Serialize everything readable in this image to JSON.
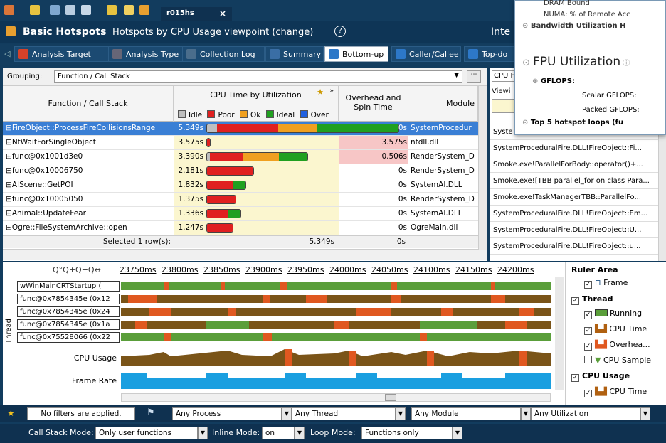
{
  "project_tab": {
    "label": "r015hs",
    "close": "×"
  },
  "header": {
    "title": "Basic Hotspots",
    "subtitle_prefix": "Hotspots by CPU Usage viewpoint (",
    "change": "change",
    "subtitle_suffix": ")",
    "help": "?",
    "right_text": "Inte"
  },
  "toolbar": {
    "back": "◁",
    "items": [
      {
        "label": "Analysis Target",
        "icon": "target-icon",
        "color": "#d6422a"
      },
      {
        "label": "Analysis Type",
        "icon": "analysis-type-icon",
        "color": "#556"
      },
      {
        "label": "Collection Log",
        "icon": "log-icon",
        "color": "#4a6d8c"
      },
      {
        "label": "Summary",
        "icon": "summary-icon",
        "color": "#3a6ea5"
      },
      {
        "label": "Bottom-up",
        "icon": "bottom-up-icon",
        "color": "#2d78c8"
      },
      {
        "label": "Caller/Callee",
        "icon": "caller-callee-icon",
        "color": "#2d78c8"
      },
      {
        "label": "Top-do",
        "icon": "top-down-icon",
        "color": "#2d78c8"
      }
    ]
  },
  "grouping": {
    "label": "Grouping:",
    "value": "Function / Call Stack"
  },
  "columns": {
    "function": "Function / Call Stack",
    "cpu": "CPU Time by Utilization",
    "overhead": "Overhead and Spin Time",
    "module": "Module",
    "legend": [
      {
        "label": "Idle",
        "color": "#bfbfbf"
      },
      {
        "label": "Poor",
        "color": "#e02020"
      },
      {
        "label": "Ok",
        "color": "#f0a020"
      },
      {
        "label": "Ideal",
        "color": "#20a020"
      },
      {
        "label": "Over",
        "color": "#2060e0"
      }
    ]
  },
  "rows": [
    {
      "fn": "FireObject::ProcessFireCollisionsRange",
      "cpu": "5.349s",
      "overhead": "0s",
      "module": "SystemProcedur",
      "selected": true,
      "pink": false,
      "bar": [
        0.08,
        0.48,
        0.3,
        0.64
      ]
    },
    {
      "fn": "NtWaitForSingleObject",
      "cpu": "3.575s",
      "overhead": "3.575s",
      "module": "ntdll.dll",
      "selected": false,
      "pink": true,
      "bar": [
        0,
        0.02,
        0,
        0
      ]
    },
    {
      "fn": "func@0x1001d3e0",
      "cpu": "3.390s",
      "overhead": "0.506s",
      "module": "RenderSystem_D",
      "selected": false,
      "pink": true,
      "bar": [
        0.02,
        0.26,
        0.28,
        0.22
      ]
    },
    {
      "fn": "func@0x10006750",
      "cpu": "2.181s",
      "overhead": "0s",
      "module": "RenderSystem_D",
      "selected": false,
      "pink": false,
      "bar": [
        0,
        0.36,
        0,
        0
      ]
    },
    {
      "fn": "AIScene::GetPOI",
      "cpu": "1.832s",
      "overhead": "0s",
      "module": "SystemAI.DLL",
      "selected": false,
      "pink": false,
      "bar": [
        0,
        0.2,
        0,
        0.1
      ]
    },
    {
      "fn": "func@0x10005050",
      "cpu": "1.375s",
      "overhead": "0s",
      "module": "RenderSystem_D",
      "selected": false,
      "pink": false,
      "bar": [
        0,
        0.22,
        0,
        0
      ]
    },
    {
      "fn": "Animal::UpdateFear",
      "cpu": "1.336s",
      "overhead": "0s",
      "module": "SystemAI.DLL",
      "selected": false,
      "pink": false,
      "bar": [
        0,
        0.16,
        0,
        0.1
      ]
    },
    {
      "fn": "Ogre::FileSystemArchive::open",
      "cpu": "1.247s",
      "overhead": "0s",
      "module": "OgreMain.dll",
      "selected": false,
      "pink": false,
      "bar": [
        0,
        0.2,
        0,
        0
      ]
    }
  ],
  "summary": {
    "label": "Selected 1 row(s):",
    "cpu": "5.349s",
    "overhead": "0s"
  },
  "right": {
    "hdr": "CPU F",
    "view": "Viewi",
    "rows": [
      "Syste",
      "SystemProceduralFire.DLL!FireObject::Fi...",
      "Smoke.exe!ParallelForBody::operator()+...",
      "Smoke.exe![TBB parallel_for on class Para...",
      "Smoke.exe!TaskManagerTBB::ParallelFo...",
      "SystemProceduralFire.DLL!FireObject::Em...",
      "SystemProceduralFire.DLL!FireObject::U...",
      "SystemProceduralFire.DLL!FireObject::u..."
    ]
  },
  "tooltip": {
    "dram": "DRAM Bound",
    "numa": "NUMA: % of Remote Acc",
    "bandwidth": "Bandwidth Utilization H",
    "fpu": "FPU Utilization",
    "gflops": "GFLOPS",
    "scalar": "Scalar GFLOPS",
    "packed": "Packed GFLOPS",
    "top5": "Top 5 hotspot loops (fu"
  },
  "timeline": {
    "zoom": "Q°Q+Q−Q↔",
    "ticks": [
      "23750ms",
      "23800ms",
      "23850ms",
      "23900ms",
      "23950ms",
      "24000ms",
      "24050ms",
      "24100ms",
      "24150ms",
      "24200ms"
    ],
    "thread_label": "Thread",
    "threads": [
      "wWinMainCRTStartup (",
      "func@0x7854345e (0x12",
      "func@0x7854345e (0x24",
      "func@0x7854345e (0x1a",
      "func@0x75528066 (0x22"
    ],
    "cpu_usage": "CPU Usage",
    "frame_rate": "Frame Rate"
  },
  "legend": {
    "ruler": "Ruler Area",
    "frame": "Frame",
    "thread": "Thread",
    "running": "Running",
    "cpu_time": "CPU Time",
    "overhead": "Overhea...",
    "cpu_sample": "CPU Sample",
    "cpu_usage": "CPU Usage",
    "cpu_time2": "CPU Time"
  },
  "filter": {
    "none": "No filters are applied.",
    "process": "Any Process",
    "thread": "Any Thread",
    "module": "Any Module",
    "util": "Any Utilization"
  },
  "bottom": {
    "csm_label": "Call Stack Mode:",
    "csm": "Only user functions",
    "inline_label": "Inline Mode:",
    "inline": "on",
    "loop_label": "Loop Mode:",
    "loop": "Functions only"
  },
  "colors": {
    "idle": "#bfbfbf",
    "poor": "#e02020",
    "ok": "#f0a020",
    "ideal": "#20a020",
    "running": "#5a9e3a",
    "overhead": "#e05820",
    "frame_rate": "#1a9fe0"
  }
}
